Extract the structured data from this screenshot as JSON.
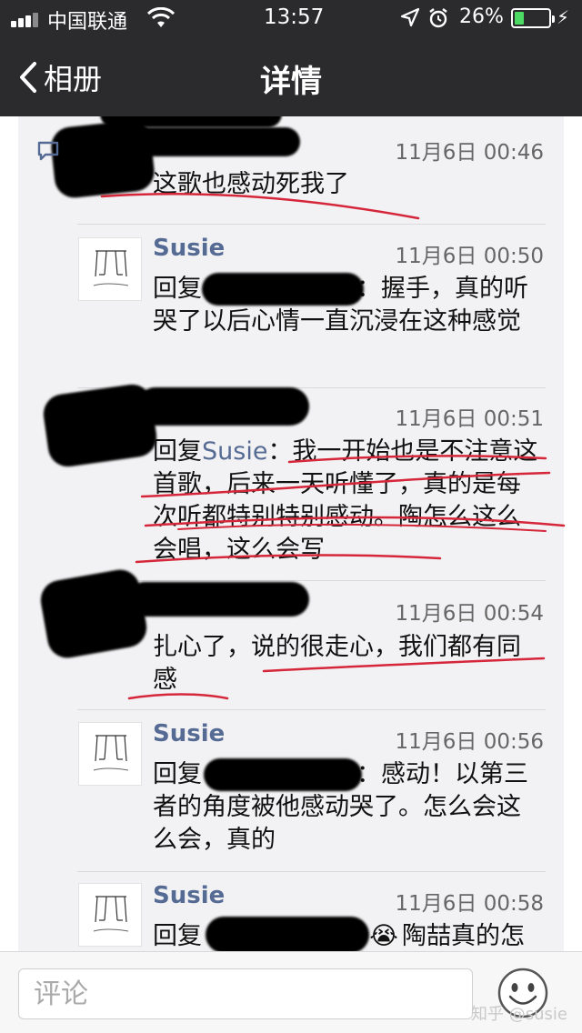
{
  "status_bar": {
    "carrier": "中国联通",
    "time": "13:57",
    "battery_percent": "26%",
    "battery_level": 0.26,
    "battery_color": "#4cd964"
  },
  "nav": {
    "back_label": "相册",
    "title": "详情"
  },
  "comments": [
    {
      "time": "11月6日 00:46",
      "text": "这歌也感动死我了"
    },
    {
      "author": "Susie",
      "time": "11月6日 00:50",
      "reply_prefix": "回复",
      "text_after": "：握手，真的听哭了以后心情一直沉浸在这种感觉"
    },
    {
      "time": "11月6日 00:51",
      "reply_prefix": "回复",
      "reply_to": "Susie",
      "text": "：我一开始也是不注意这首歌，后来一天听懂了，真的是每次听都特别特别感动。陶怎么这么会唱，这么会写"
    },
    {
      "time": "11月6日 00:54",
      "text": "扎心了，说的很走心，我们都有同感"
    },
    {
      "author": "Susie",
      "time": "11月6日 00:56",
      "reply_prefix": "回复",
      "text_after": "：感动！以第三者的角度被他感动哭了。怎么会这么会，真的"
    },
    {
      "author": "Susie",
      "time": "11月6日 00:58",
      "reply_prefix": "回复",
      "text_after": "陶喆真的怎"
    }
  ],
  "input": {
    "placeholder": "评论"
  },
  "watermark": "知乎 @susie",
  "colors": {
    "nav_bg": "#2b2b2e",
    "author_link": "#566b94",
    "panel_bg": "#f2f2f4",
    "underline_red": "#d6263a"
  }
}
